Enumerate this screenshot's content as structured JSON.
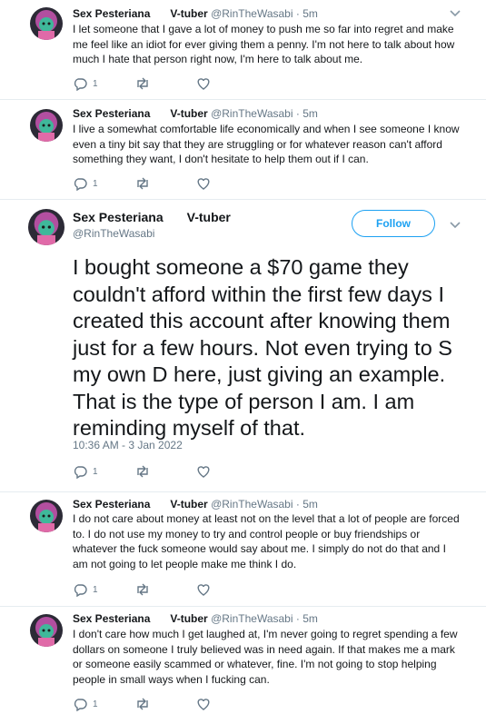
{
  "tweets_before": [
    {
      "name": "Sex Pesteriana",
      "tag": "V-tuber",
      "handle": "@RinTheWasabi",
      "dot": "·",
      "age": "5m",
      "lines": "I let someone that I gave a lot of money to push me so far into regret and make\nme feel like an idiot for ever giving them a penny. I'm not here to talk about how\nmuch I hate that person right now, I'm here to talk about me.",
      "reply_count": "1"
    },
    {
      "name": "Sex Pesteriana",
      "tag": "V-tuber",
      "handle": "@RinTheWasabi",
      "dot": "·",
      "age": "5m",
      "lines": "I live a somewhat comfortable life economically and when I see someone I know\neven a tiny bit say that they are struggling or for whatever reason can't afford\nsomething they want, I don't hesitate to help them out if I can.",
      "reply_count": "1"
    }
  ],
  "focused": {
    "name": "Sex Pesteriana",
    "tag": "V-tuber",
    "handle": "@RinTheWasabi",
    "follow_label": "Follow",
    "text": "I bought someone a $70 game they\ncouldn't afford within the first few days I\ncreated this account after knowing them\njust for a few hours. Not even trying to S\nmy own D here, just giving an example.\nThat is the type of person I am. I am\nreminding myself of that.",
    "timestamp": "10:36 AM - 3 Jan 2022",
    "reply_count": "1"
  },
  "tweets_after": [
    {
      "name": "Sex Pesteriana",
      "tag": "V-tuber",
      "handle": "@RinTheWasabi",
      "dot": "·",
      "age": "5m",
      "lines": "I do not care about money at least not on the level that a lot of people are forced\nto. I do not use my money to try and control people or buy friendships or\nwhatever the fuck someone would say about me. I simply do not do that and I\nam not going to let people make me think I do.",
      "reply_count": "1"
    },
    {
      "name": "Sex Pesteriana",
      "tag": "V-tuber",
      "handle": "@RinTheWasabi",
      "dot": "·",
      "age": "5m",
      "lines": "I don't care how much I get laughed at, I'm never going to regret spending a few\ndollars on someone I truly believed was in need again. If that makes me a mark\nor someone easily scammed or whatever, fine. I'm not going to stop helping\npeople in small ways when I fucking can.",
      "reply_count": "1"
    }
  ],
  "icons": {
    "reply": "reply-icon",
    "retweet": "retweet-icon",
    "like": "like-icon",
    "more": "chevron-down-icon"
  },
  "colors": {
    "follow_blue": "#1da1f2",
    "secondary_text": "#657786",
    "divider": "#e6ecf0"
  }
}
